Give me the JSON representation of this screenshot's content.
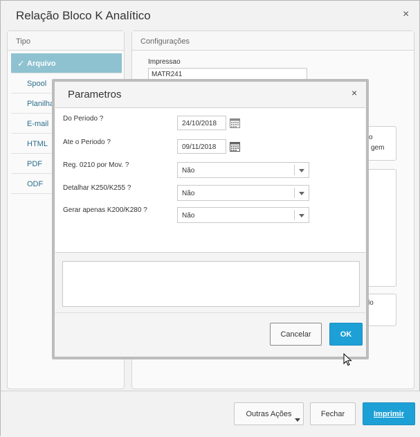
{
  "window": {
    "title": "Relação Bloco K Analítico",
    "close_glyph": "×"
  },
  "tipo": {
    "header": "Tipo",
    "items": [
      {
        "label": "Arquivo",
        "active": true
      },
      {
        "label": "Spool"
      },
      {
        "label": "Planilha"
      },
      {
        "label": "E-mail"
      },
      {
        "label": "HTML"
      },
      {
        "label": "PDF"
      },
      {
        "label": "ODF"
      }
    ]
  },
  "config": {
    "header": "Configurações",
    "impressao_label": "Impressao",
    "impressao_value": "MATR241",
    "partial_o": "o",
    "partial_gem": "gem",
    "partial_lo": "lo"
  },
  "modal": {
    "title": "Parametros",
    "close_glyph": "×",
    "params": [
      {
        "label": "Do Periodo ?",
        "value": "24/10/2018"
      },
      {
        "label": "Ate o Periodo ?",
        "value": "09/11/2018"
      },
      {
        "label": "Reg. 0210 por Mov. ?",
        "value": "Não"
      },
      {
        "label": "Detalhar K250/K255 ?",
        "value": "Não"
      },
      {
        "label": "Gerar apenas K200/K280 ?",
        "value": "Não"
      }
    ],
    "cancel_label": "Cancelar",
    "ok_label": "OK"
  },
  "footer": {
    "outras_label": "Outras Ações",
    "fechar_label": "Fechar",
    "imprimir_label": "Imprimir"
  },
  "colors": {
    "accent": "#1da0d6",
    "active_tab": "#8ec2d0",
    "link": "#2b6d8c"
  }
}
